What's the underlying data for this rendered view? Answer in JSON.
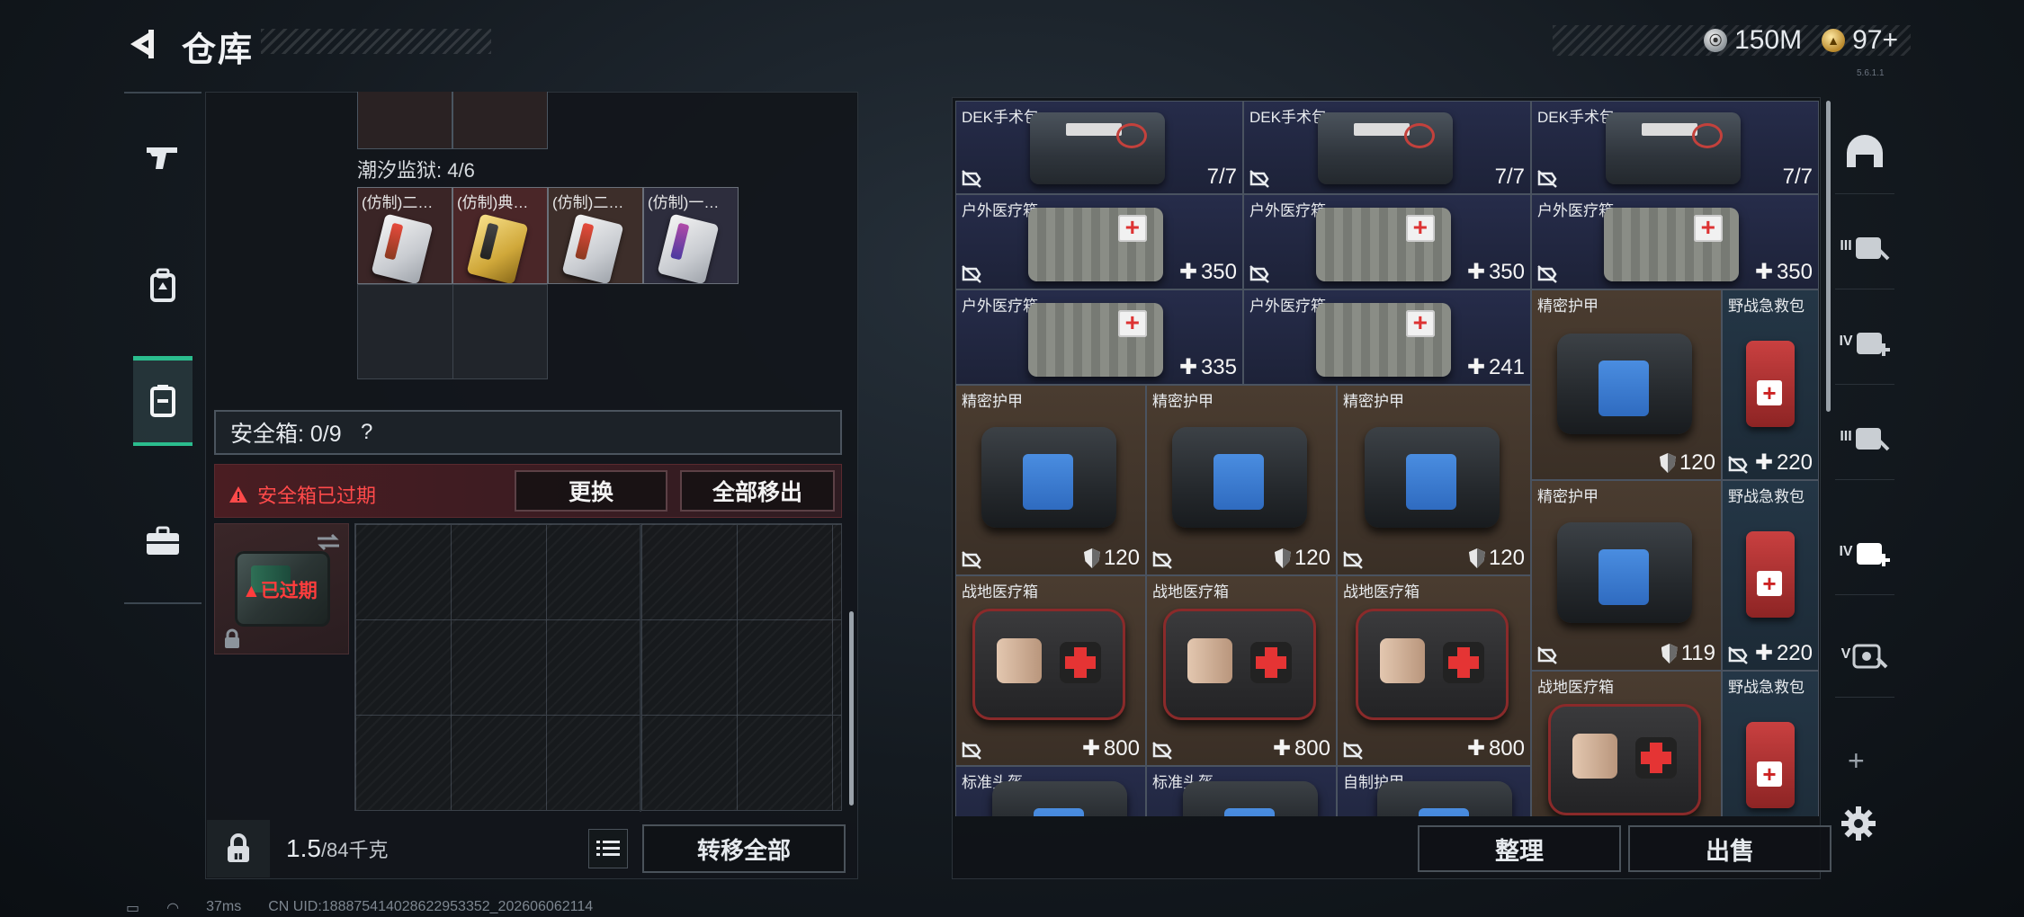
{
  "header": {
    "title": "仓库",
    "currency_silver": "150M",
    "currency_gold": "97+",
    "version": "5.6.1.1"
  },
  "left_tabs": [
    "pistol-tab",
    "backpack-tab",
    "safebox-tab",
    "briefcase-tab"
  ],
  "left_panel": {
    "prison_label": "潮汐监狱: 4/6",
    "sample_items": [
      {
        "label": "(仿制)二…",
        "variant": "red"
      },
      {
        "label": "(仿制)典…",
        "variant": "gold"
      },
      {
        "label": "(仿制)二…",
        "variant": "red"
      },
      {
        "label": "(仿制)一…",
        "variant": "purple"
      }
    ],
    "safebox_label": "安全箱: 0/9",
    "safebox_help": "?",
    "expired_warning": "安全箱已过期",
    "replace_button": "更换",
    "remove_all_button": "全部移出",
    "safe_thumb_status": "已过期",
    "weight_current": "1.5",
    "weight_capacity": "/84千克",
    "transfer_all_button": "转移全部"
  },
  "inventory": [
    {
      "name": "DEK手术包",
      "value": "7/7",
      "kind": "pouch"
    },
    {
      "name": "DEK手术包",
      "value": "7/7",
      "kind": "pouch"
    },
    {
      "name": "DEK手术包",
      "value": "7/7",
      "kind": "pouch"
    },
    {
      "name": "户外医疗箱",
      "value": "350",
      "kind": "medkit"
    },
    {
      "name": "户外医疗箱",
      "value": "350",
      "kind": "medkit"
    },
    {
      "name": "户外医疗箱",
      "value": "350",
      "kind": "medkit"
    },
    {
      "name": "户外医疗箱",
      "value": "335",
      "kind": "medkit"
    },
    {
      "name": "户外医疗箱",
      "value": "241",
      "kind": "medkit"
    },
    {
      "name": "精密护甲",
      "value": "120",
      "kind": "armor"
    },
    {
      "name": "野战急救包",
      "value": "220",
      "kind": "redkit"
    },
    {
      "name": "精密护甲",
      "value": "120",
      "kind": "armor"
    },
    {
      "name": "精密护甲",
      "value": "120",
      "kind": "armor"
    },
    {
      "name": "精密护甲",
      "value": "120",
      "kind": "armor"
    },
    {
      "name": "精密护甲",
      "value": "119",
      "kind": "armor"
    },
    {
      "name": "野战急救包",
      "value": "220",
      "kind": "redkit"
    },
    {
      "name": "战地医疗箱",
      "value": "800",
      "kind": "firstaid"
    },
    {
      "name": "战地医疗箱",
      "value": "800",
      "kind": "firstaid"
    },
    {
      "name": "战地医疗箱",
      "value": "800",
      "kind": "firstaid"
    },
    {
      "name": "战地医疗箱",
      "value": "",
      "kind": "firstaid"
    },
    {
      "name": "野战急救包",
      "value": "",
      "kind": "redkit"
    },
    {
      "name": "标准头盔",
      "value": "",
      "kind": "armor"
    },
    {
      "name": "标准头盔",
      "value": "",
      "kind": "armor"
    },
    {
      "name": "自制护甲",
      "value": "",
      "kind": "armor"
    }
  ],
  "right_buttons": {
    "organize": "整理",
    "sell": "出售"
  },
  "right_tabs": [
    {
      "label": "",
      "icon": "helmet-icon"
    },
    {
      "label": "III",
      "icon": "armor-iii-icon"
    },
    {
      "label": "IV",
      "icon": "med-iv-icon"
    },
    {
      "label": "III",
      "icon": "armor-iii-icon-2"
    },
    {
      "label": "IV",
      "icon": "med-iv-icon-2"
    },
    {
      "label": "V",
      "icon": "armor-v-icon"
    }
  ],
  "status_bar": {
    "ping": "37ms",
    "uid": "CN UID:18887541402862295335​2_202606062114"
  }
}
